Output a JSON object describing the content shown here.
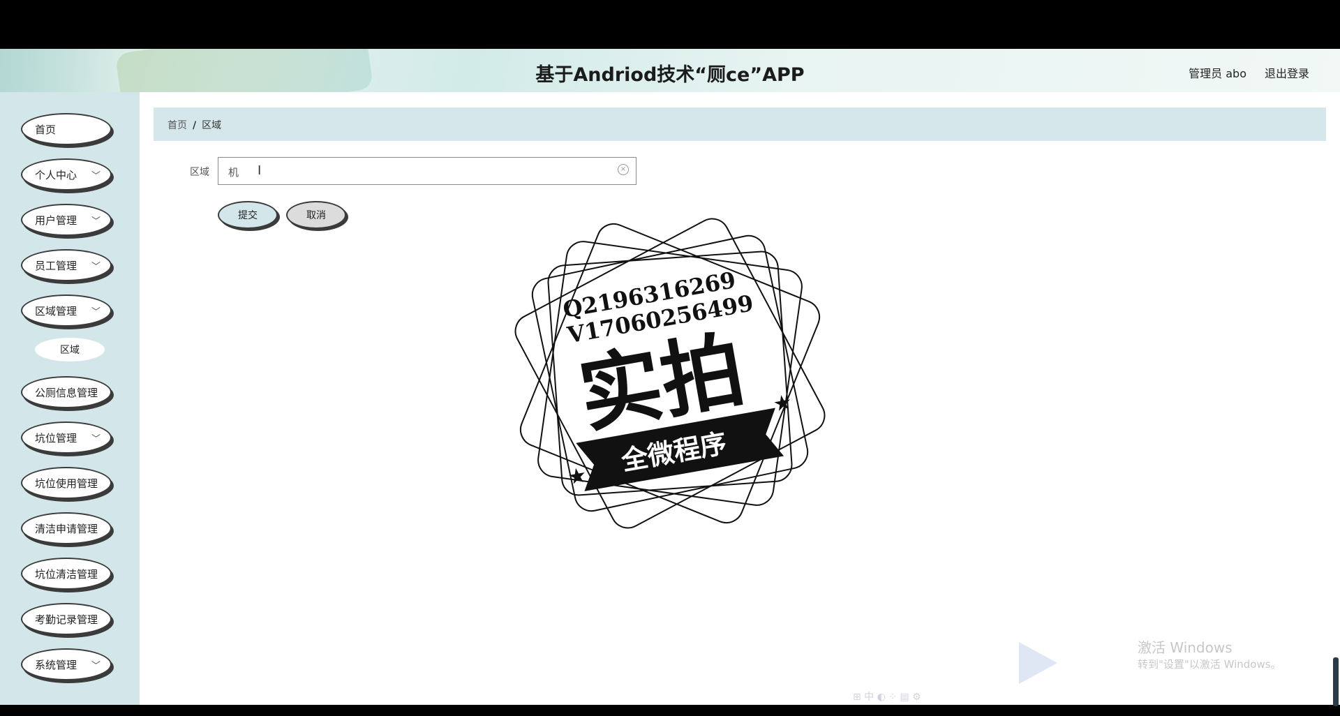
{
  "header": {
    "title": "基于Andriod技术“厕ce”APP",
    "user": "管理员 abo",
    "logout": "退出登录"
  },
  "sidebar": {
    "items": [
      {
        "label": "首页",
        "chevron": false
      },
      {
        "label": "个人中心",
        "chevron": true
      },
      {
        "label": "用户管理",
        "chevron": true
      },
      {
        "label": "员工管理",
        "chevron": true
      },
      {
        "label": "区域管理",
        "chevron": true
      },
      {
        "label": "公厕信息管理",
        "chevron": false
      },
      {
        "label": "坑位管理",
        "chevron": true
      },
      {
        "label": "坑位使用管理",
        "chevron": false
      },
      {
        "label": "清洁申请管理",
        "chevron": false
      },
      {
        "label": "坑位清洁管理",
        "chevron": false
      },
      {
        "label": "考勤记录管理",
        "chevron": false
      },
      {
        "label": "系统管理",
        "chevron": true
      }
    ],
    "subitem": "区域"
  },
  "breadcrumb": {
    "home": "首页",
    "separator": "/",
    "current": "区域"
  },
  "form": {
    "label": "区域",
    "value": "机",
    "submit": "提交",
    "cancel": "取消"
  },
  "stamp": {
    "line1": "Q2196316269",
    "line2": "V17060256499",
    "main": "实拍",
    "banner": "全微程序"
  },
  "os": {
    "watermark_title": "激活 Windows",
    "watermark_sub": "转到\"设置\"以激活 Windows。"
  },
  "colors": {
    "sidebar_bg": "#d3e6ea",
    "breadcrumb_bg": "#d6e7eb",
    "submit_bg": "#d3e6ea",
    "cancel_bg": "#dcdcdc"
  }
}
